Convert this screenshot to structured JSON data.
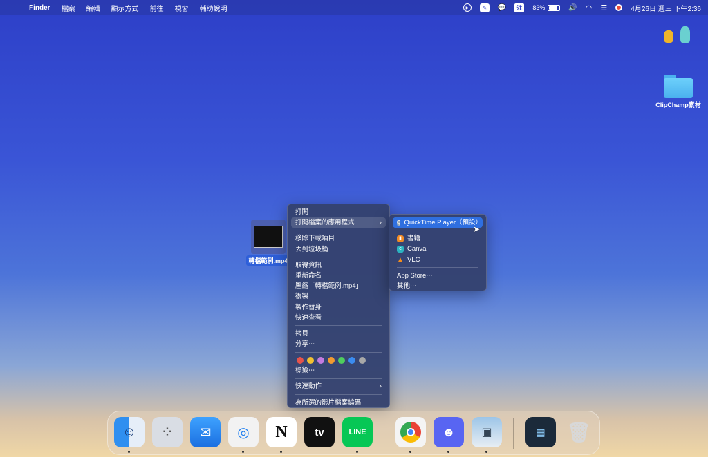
{
  "menubar": {
    "app_name": "Finder",
    "menus": [
      "檔案",
      "編輯",
      "顯示方式",
      "前往",
      "視窗",
      "輔助說明"
    ],
    "status": {
      "input_method": "注",
      "battery": "83%",
      "datetime": "4月26日 週三 下午2:36"
    },
    "icons": [
      "apple-icon",
      "play-circle-icon",
      "pen-icon",
      "line-chat-icon",
      "input-method-icon",
      "battery-icon",
      "volume-icon",
      "wifi-icon",
      "control-center-icon",
      "siri-icon"
    ]
  },
  "desktop": {
    "file_label": "轉檔範例.mp4",
    "folder_label": "ClipChamp素材"
  },
  "context_menu": {
    "open": "打開",
    "open_with": "打開檔案的應用程式",
    "remove_download": "移除下載項目",
    "trash": "丟到垃圾桶",
    "get_info": "取得資訊",
    "rename": "重新命名",
    "compress": "壓縮「轉檔範例.mp4」",
    "duplicate": "複製",
    "make_alias": "製作替身",
    "quick_look": "快速查看",
    "copy": "拷貝",
    "share": "分享⋯",
    "tag_colors": [
      "#e5534b",
      "#f2c230",
      "#c47be0",
      "#f29b30",
      "#4fce5d",
      "#3b8cf0",
      "#a8a8a8"
    ],
    "tags": "標籤⋯",
    "quick_actions": "快速動作",
    "encode": "為所選的影片檔案編碼"
  },
  "open_with_menu": {
    "default_app": "QuickTime Player（預設）",
    "apps": [
      "書籍",
      "Canva",
      "VLC"
    ],
    "app_store": "App Store⋯",
    "other": "其他⋯"
  },
  "dock": {
    "apps": [
      "Finder",
      "Launchpad",
      "Mail",
      "Safari",
      "Notion",
      "Apple TV",
      "LINE",
      "Chrome",
      "Discord",
      "Preview",
      "Screenshot",
      "Trash"
    ],
    "running": [
      "Finder",
      "Safari",
      "Notion",
      "LINE",
      "Chrome",
      "Discord",
      "Preview"
    ],
    "labels": {
      "notion": "N",
      "tv": "tv",
      "line": "LINE"
    }
  }
}
